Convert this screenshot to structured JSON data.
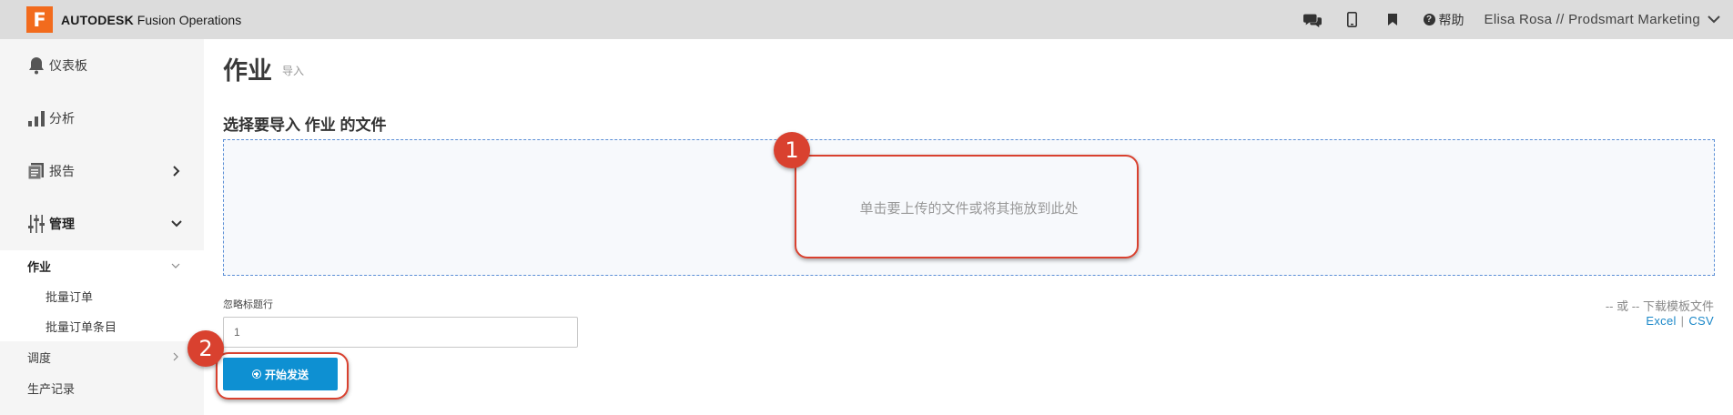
{
  "header": {
    "logo_letter": "F",
    "brand_bold": "AUTODESK",
    "brand_rest": " Fusion Operations",
    "help_label": "帮助",
    "user_label": "Elisa Rosa // Prodsmart Marketing",
    "icons": [
      "chat-icon",
      "mobile-icon",
      "bookmark-icon",
      "help-icon",
      "chevron-down-icon"
    ],
    "logo_color": "#f26b1d"
  },
  "sidebar": {
    "items": [
      {
        "label": "仪表板",
        "icon": "bell-icon"
      },
      {
        "label": "分析",
        "icon": "bar-chart-icon"
      },
      {
        "label": "报告",
        "icon": "report-icon"
      },
      {
        "label": "管理",
        "icon": "sliders-icon"
      }
    ],
    "sub_active": "作业",
    "sub_children": [
      "批量订单",
      "批量订单条目"
    ],
    "sub_items": [
      "调度",
      "生产记录"
    ]
  },
  "main": {
    "title": "作业",
    "subtitle": "导入",
    "section_title": "选择要导入 作业 的文件",
    "dropzone_text": "单击要上传的文件或将其拖放到此处",
    "ignore_label": "忽略标题行",
    "ignore_value": "1",
    "template_text": "-- 或 -- 下载模板文件",
    "link_excel": "Excel",
    "link_sep": "|",
    "link_csv": "CSV",
    "start_button": "开始发送",
    "accent_color": "#0e90d2"
  },
  "annotations": {
    "callout_1": "1",
    "callout_2": "2",
    "color": "#d9412f"
  }
}
